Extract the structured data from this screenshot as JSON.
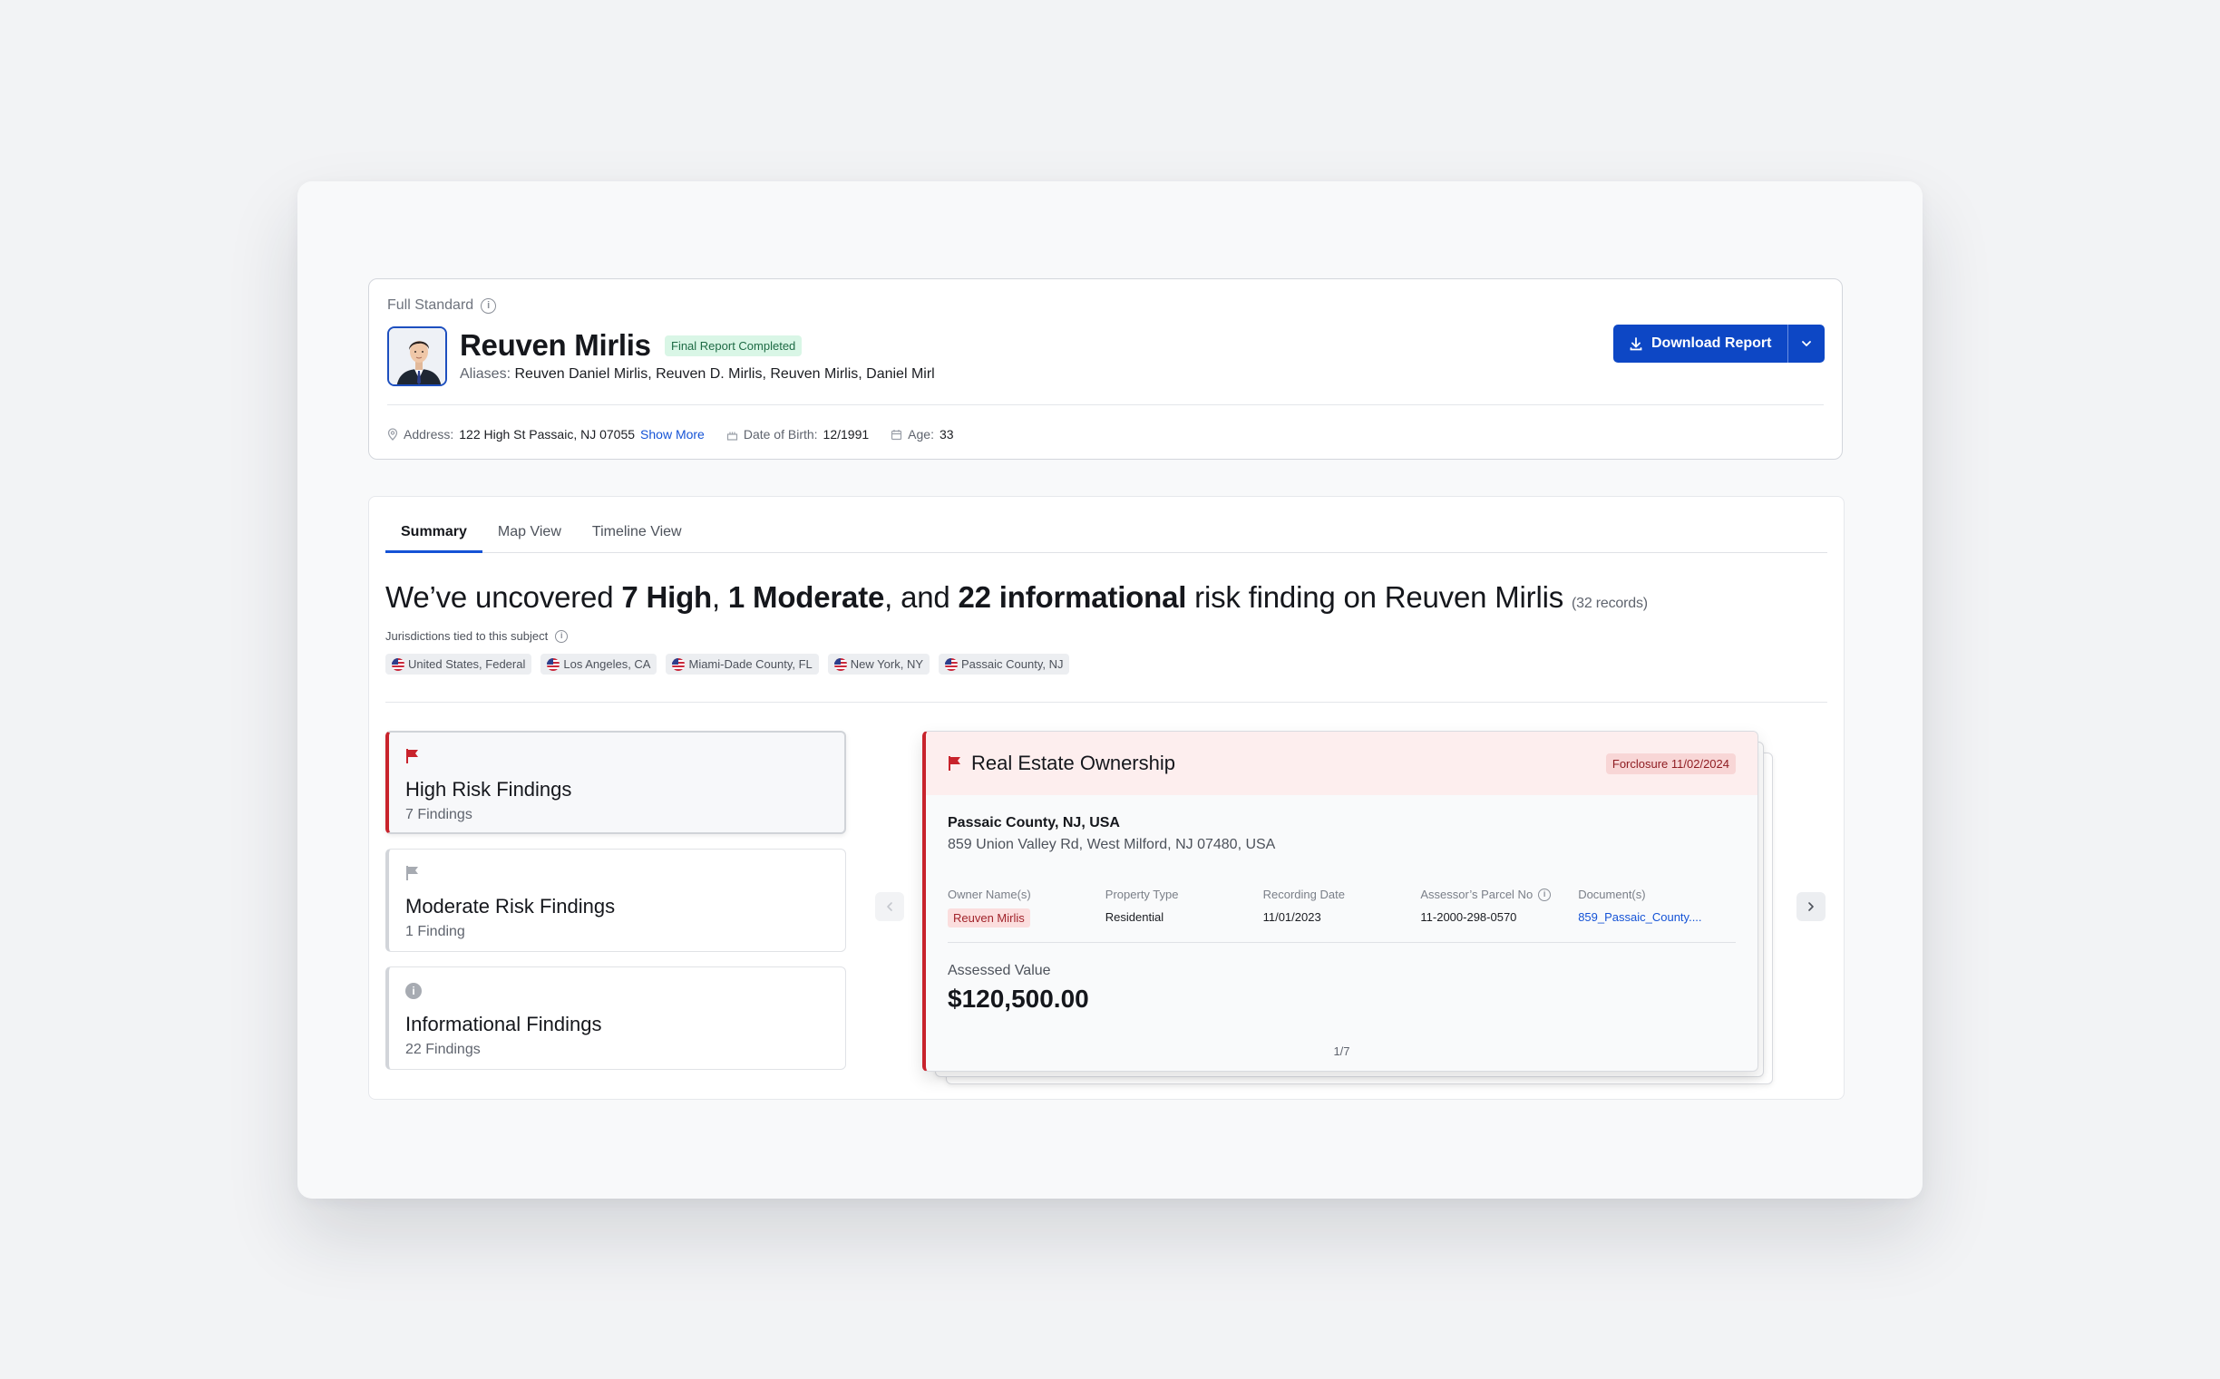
{
  "header": {
    "report_type": "Full Standard",
    "name": "Reuven Mirlis",
    "status": "Final Report Completed",
    "aliases_label": "Aliases:",
    "aliases": "Reuven Daniel Mirlis, Reuven D. Mirlis, Reuven Mirlis, Daniel Mirl",
    "download_label": "Download Report",
    "address_label": "Address:",
    "address": "122 High St Passaic, NJ 07055",
    "show_more": "Show More",
    "dob_label": "Date of Birth:",
    "dob": "12/1991",
    "age_label": "Age:",
    "age": "33"
  },
  "tabs": [
    "Summary",
    "Map View",
    "Timeline View"
  ],
  "headline": {
    "prefix": "We’ve uncovered ",
    "high": "7 High",
    "sep1": ", ",
    "moderate": "1 Moderate",
    "sep2": ", and ",
    "informational": "22 informational",
    "suffix": " risk finding on Reuven Mirlis ",
    "records": "(32 records)"
  },
  "jurisdictions": {
    "label": "Jurisdictions tied to this subject",
    "items": [
      "United States, Federal",
      "Los Angeles, CA",
      "Miami-Dade County, FL",
      "New York, NY",
      "Passaic County, NJ"
    ]
  },
  "findings": [
    {
      "title": "High Risk Findings",
      "count": "7 Findings"
    },
    {
      "title": "Moderate Risk Findings",
      "count": "1 Finding"
    },
    {
      "title": "Informational Findings",
      "count": "22 Findings"
    }
  ],
  "detail": {
    "title": "Real Estate Ownership",
    "badge": "Forclosure 11/02/2024",
    "location_name": "Passaic County, NJ, USA",
    "location_address": "859 Union Valley Rd, West Milford, NJ 07480, USA",
    "fields": {
      "owner_label": "Owner Name(s)",
      "owner_value": "Reuven Mirlis",
      "property_label": "Property Type",
      "property_value": "Residential",
      "recording_label": "Recording Date",
      "recording_value": "11/01/2023",
      "parcel_label": "Assessor’s Parcel No",
      "parcel_value": "11-2000-298-0570",
      "documents_label": "Document(s)",
      "documents_value": "859_Passaic_County...."
    },
    "assessed_label": "Assessed Value",
    "assessed_value": "$120,500.00",
    "pager": "1/7"
  },
  "colors": {
    "primary": "#0d47c5",
    "high_risk": "#c8232c",
    "success_bg": "#d9f6e6"
  }
}
